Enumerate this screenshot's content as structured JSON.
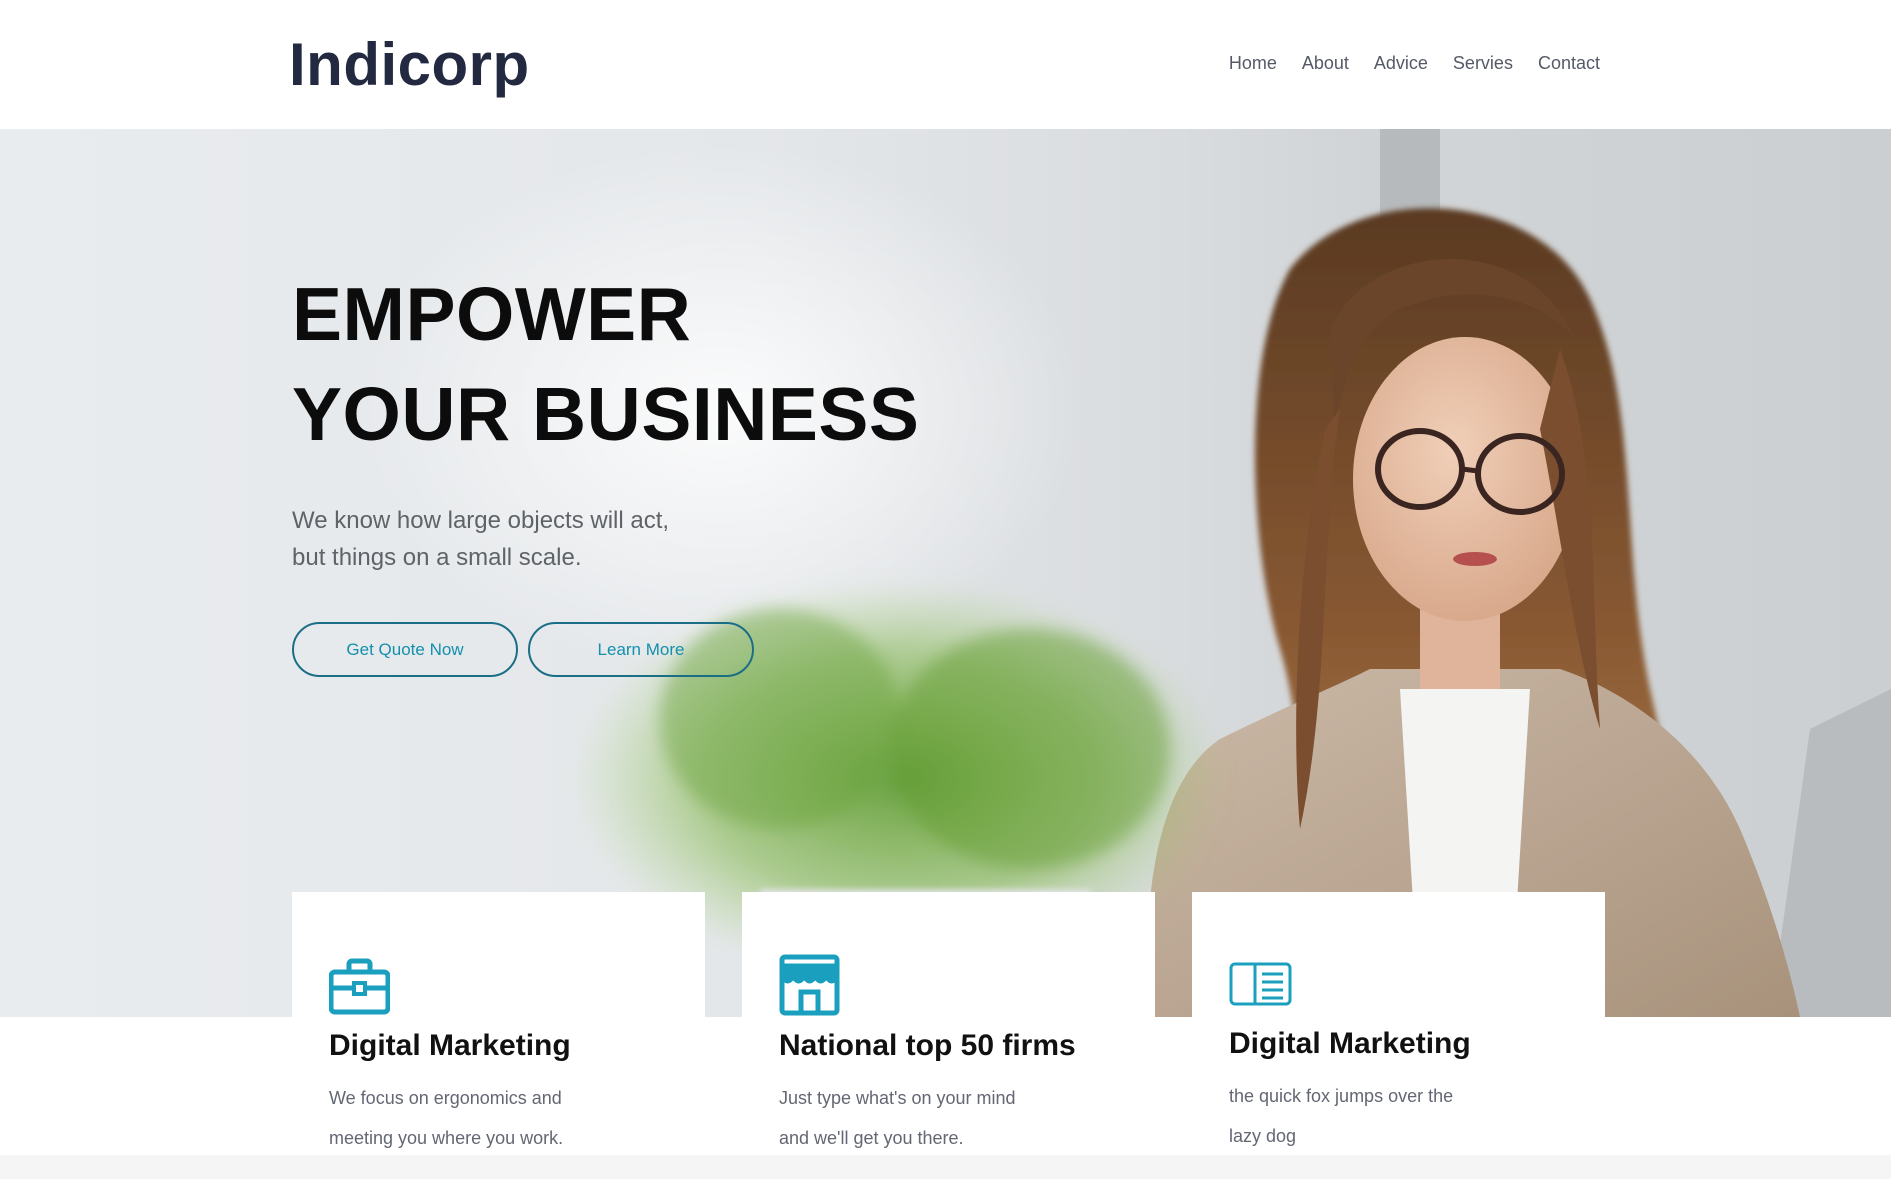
{
  "brand": {
    "logo": "Indicorp"
  },
  "nav": [
    {
      "label": "Home"
    },
    {
      "label": "About"
    },
    {
      "label": "Advice"
    },
    {
      "label": "Servies"
    },
    {
      "label": "Contact"
    }
  ],
  "hero": {
    "title_line1": "EMPOWER",
    "title_line2": "YOUR BUSINESS",
    "subtitle_line1": "We know how large objects will act,",
    "subtitle_line2": "but things on a small scale.",
    "cta_primary": "Get Quote Now",
    "cta_secondary": "Learn More"
  },
  "features": [
    {
      "icon": "briefcase-icon",
      "title": "Digital Marketing",
      "text_line1": "We focus on ergonomics and",
      "text_line2": "meeting you where you work."
    },
    {
      "icon": "storefront-icon",
      "title": "National top 50 firms",
      "text_line1": "Just type what's on your mind",
      "text_line2": "and we'll get you there."
    },
    {
      "icon": "reader-icon",
      "title": "Digital Marketing",
      "text_line1": "the quick fox jumps over the",
      "text_line2": "lazy dog"
    }
  ],
  "colors": {
    "brand": "#232940",
    "accent": "#1390ad",
    "button_border": "#1a6f86",
    "icon": "#1a9fbf"
  }
}
